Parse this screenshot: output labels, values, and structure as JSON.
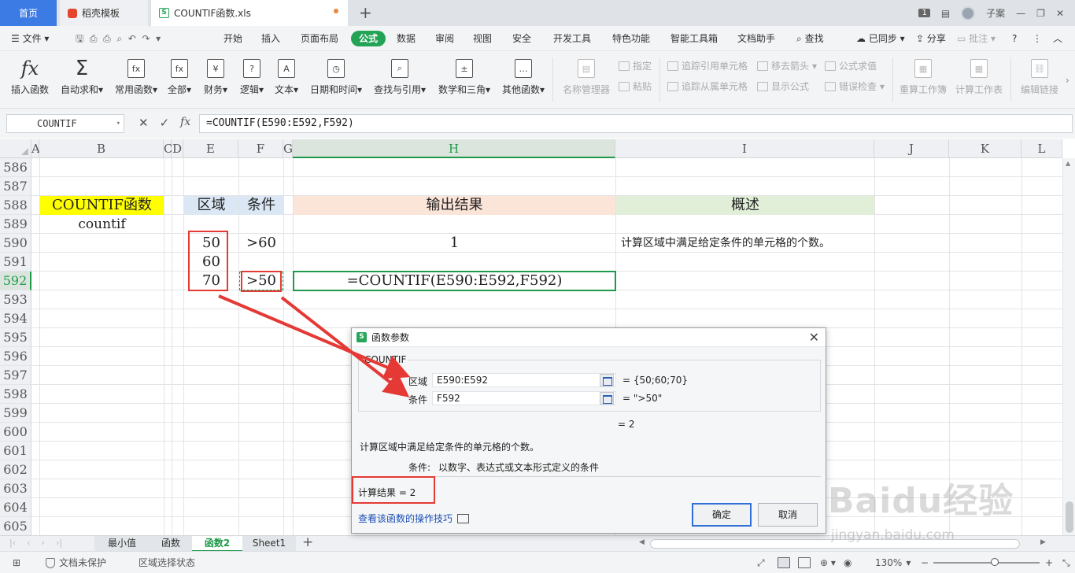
{
  "titlebar": {
    "tabs": [
      {
        "label": "首页"
      },
      {
        "label": "稻壳模板"
      },
      {
        "label": "COUNTIF函数.xls"
      }
    ],
    "page_badge": "1",
    "user": "子案"
  },
  "menu": {
    "file": "文件",
    "items": [
      "开始",
      "插入",
      "页面布局",
      "公式",
      "数据",
      "审阅",
      "视图",
      "安全",
      "开发工具",
      "特色功能",
      "智能工具箱",
      "文档助手"
    ],
    "active": "公式",
    "search": "查找",
    "synced": "已同步",
    "share": "分享",
    "comment": "批注"
  },
  "ribbon": {
    "big": [
      {
        "label": "插入函数",
        "glyph": "fx"
      },
      {
        "label": "自动求和",
        "glyph": "Σ"
      },
      {
        "label": "常用函数",
        "glyph": "fx"
      },
      {
        "label": "全部",
        "glyph": "fx"
      },
      {
        "label": "财务",
        "glyph": "¥"
      },
      {
        "label": "逻辑",
        "glyph": "?"
      },
      {
        "label": "文本",
        "glyph": "A"
      },
      {
        "label": "日期和时间",
        "glyph": "◷"
      },
      {
        "label": "查找与引用",
        "glyph": "⌕"
      },
      {
        "label": "数学和三角",
        "glyph": "±"
      },
      {
        "label": "其他函数",
        "glyph": "…"
      }
    ],
    "name_manager": "名称管理器",
    "define": "指定",
    "paste": "粘贴",
    "trace_precedents": "追踪引用单元格",
    "trace_dependents": "追踪从属单元格",
    "remove_arrows": "移去箭头",
    "show_formulas": "显示公式",
    "eval_formula": "公式求值",
    "error_check": "错误检查",
    "recalc_workbook": "重算工作簿",
    "calc_sheet": "计算工作表",
    "edit_links": "编辑链接"
  },
  "formula_bar": {
    "name_box": "COUNTIF",
    "formula": "=COUNTIF(E590:E592,F592)"
  },
  "grid": {
    "columns": [
      "A",
      "B",
      "C",
      "D",
      "E",
      "F",
      "G",
      "H",
      "I",
      "J",
      "K",
      "L"
    ],
    "selected_col": "H",
    "rows": [
      "586",
      "587",
      "588",
      "589",
      "590",
      "591",
      "592",
      "593",
      "594",
      "595",
      "596",
      "597",
      "598",
      "599",
      "600",
      "601",
      "602",
      "603",
      "604",
      "605"
    ],
    "selected_row": "592",
    "cells": {
      "b588": "COUNTIF函数",
      "b589": "countif",
      "e588": "区域",
      "f588": "条件",
      "h588": "输出结果",
      "i588": "概述",
      "e590": "50",
      "e591": "60",
      "e592": "70",
      "f590": ">60",
      "f592": ">50",
      "h590": "1",
      "h592": "=COUNTIF(E590:E592,F592)",
      "i590": "计算区域中满足给定条件的单元格的个数。"
    },
    "colors": {
      "b588_bg": "#ffff00",
      "ef588_bg": "#dbe7f5",
      "h588_bg": "#fbe4d8",
      "i588_bg": "#e1efd9",
      "annotation_red": "#e53935",
      "select_green": "#1f9a4a"
    }
  },
  "sheets": {
    "tabs": [
      "最小值",
      "函数",
      "函数2",
      "Sheet1"
    ],
    "active": "函数2"
  },
  "statusbar": {
    "protect": "文档未保护",
    "mode": "区域选择状态",
    "zoom": "130%"
  },
  "dialog": {
    "title": "函数参数",
    "function_name": "COUNTIF",
    "arg1_label": "区域",
    "arg1_value": "E590:E592",
    "arg1_result": "= {50;60;70}",
    "arg2_label": "条件",
    "arg2_value": "F592",
    "arg2_result": "= \">50\"",
    "formula_result": "= 2",
    "description": "计算区域中满足给定条件的单元格的个数。",
    "param_name": "条件:",
    "param_desc": "以数字、表达式或文本形式定义的条件",
    "calc_result_label": "计算结果 = 2",
    "help_link": "查看该函数的操作技巧",
    "ok": "确定",
    "cancel": "取消"
  },
  "watermark": {
    "brand": "Baidu经验",
    "url": "jingyan.baidu.com"
  }
}
